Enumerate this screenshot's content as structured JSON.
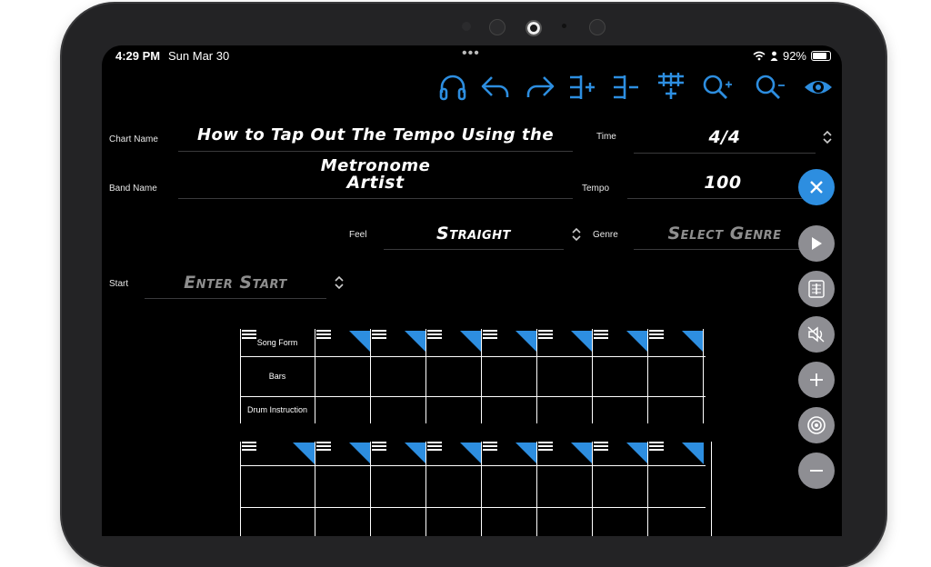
{
  "status_bar": {
    "time": "4:29 PM",
    "date": "Sun Mar 30",
    "dots": "•••",
    "battery": "92%"
  },
  "toolbar": {
    "accent_color": "#2d8ee0",
    "icons": [
      "headphones-icon",
      "undo-icon",
      "redo-icon",
      "add-measure-icon",
      "remove-measure-icon",
      "add-line-icon",
      "zoom-in-icon",
      "zoom-out-icon",
      "eye-icon"
    ]
  },
  "form": {
    "chart_name_label": "Chart Name",
    "chart_name_value": "How to Tap Out The Tempo Using the Metronome",
    "time_label": "Time",
    "time_value": "4/4",
    "band_name_label": "Band Name",
    "band_name_value": "Artist",
    "tempo_label": "Tempo",
    "tempo_value": "100",
    "feel_label": "Feel",
    "feel_value": "Straight",
    "genre_label": "Genre",
    "genre_placeholder": "Select Genre",
    "start_label": "Start",
    "start_placeholder": "Enter Start"
  },
  "grid": {
    "row_labels": [
      "Song Form",
      "Bars",
      "Drum Instruction"
    ]
  },
  "side_buttons": [
    "close-icon",
    "play-icon",
    "music-sheet-icon",
    "mute-icon",
    "plus-icon",
    "target-icon",
    "minus-icon"
  ]
}
